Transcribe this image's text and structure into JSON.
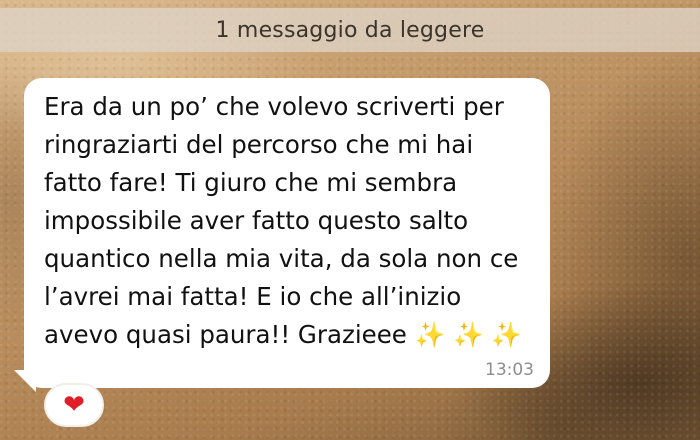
{
  "unread_banner": {
    "text": "1 messaggio da leggere"
  },
  "message": {
    "text": "Era da un po’ che volevo scriverti per\nringraziarti del percorso che mi hai\nfatto fare! Ti giuro che mi sembra\nimpossibile aver fatto questo salto\nquantico nella mia vita, da sola non ce\nl’avrei mai fatta! E io che all’inizio\navevo quasi paura!! Grazieee ✨ ✨ ✨",
    "time": "13:03",
    "reaction": "❤",
    "reaction_icon": "heart-icon"
  },
  "colors": {
    "bubble": "#ffffff",
    "heart": "#e11d2a",
    "sparkle": "#f4c542"
  }
}
